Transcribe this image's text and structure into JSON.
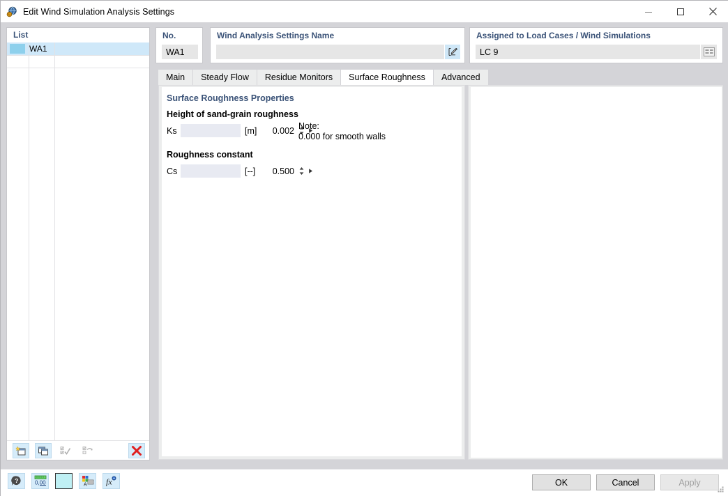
{
  "window": {
    "title": "Edit Wind Simulation Analysis Settings",
    "app_icon": "wind-simulation-icon",
    "minimize_icon": "minimize-icon",
    "maximize_icon": "maximize-icon",
    "close_icon": "close-icon"
  },
  "list_panel": {
    "header": "List",
    "rows": [
      {
        "label": "WA1",
        "color": "#8ed0ec",
        "selected": true
      }
    ],
    "toolbar": {
      "new_icon": "new-item-icon",
      "copy_icon": "copy-item-icon",
      "select_all_icon": "select-all-icon",
      "invert_icon": "invert-selection-icon",
      "delete_icon": "delete-icon"
    }
  },
  "fields": {
    "no": {
      "title": "No.",
      "value": "WA1"
    },
    "name": {
      "title": "Wind Analysis Settings Name",
      "value": "",
      "placeholder": "",
      "edit_icon": "edit-pencil-icon"
    },
    "assigned": {
      "title": "Assigned to Load Cases / Wind Simulations",
      "value": "LC 9",
      "list_icon": "table-list-icon"
    }
  },
  "tabs": [
    {
      "label": "Main",
      "active": false
    },
    {
      "label": "Steady Flow",
      "active": false
    },
    {
      "label": "Residue Monitors",
      "active": false
    },
    {
      "label": "Surface Roughness",
      "active": true
    },
    {
      "label": "Advanced",
      "active": false
    }
  ],
  "surface_roughness": {
    "section_title": "Surface Roughness Properties",
    "group1_label": "Height of sand-grain roughness",
    "ks": {
      "symbol": "Ks",
      "value": "0.002",
      "unit": "[m]"
    },
    "group2_label": "Roughness constant",
    "cs": {
      "symbol": "Cs",
      "value": "0.500",
      "unit": "[--]"
    },
    "note": "Note:\n0.000 for smooth walls"
  },
  "statusbar": {
    "help_icon": "help-question-icon",
    "decimals_icon": "decimal-places-icon",
    "color_swatch_icon": "color-swatch-icon",
    "renumber_icon": "renumber-icon",
    "formula_icon": "formula-fx-icon"
  },
  "dialog_buttons": {
    "ok": "OK",
    "cancel": "Cancel",
    "apply": "Apply",
    "apply_disabled": true
  },
  "colors": {
    "accent_heading": "#3b5378",
    "selection": "#cfe8f9",
    "window_bg": "#d4d4d8",
    "field_bg": "#e6e6e6",
    "spin_bg": "#e8eaf2",
    "delete_red": "#e02020"
  }
}
